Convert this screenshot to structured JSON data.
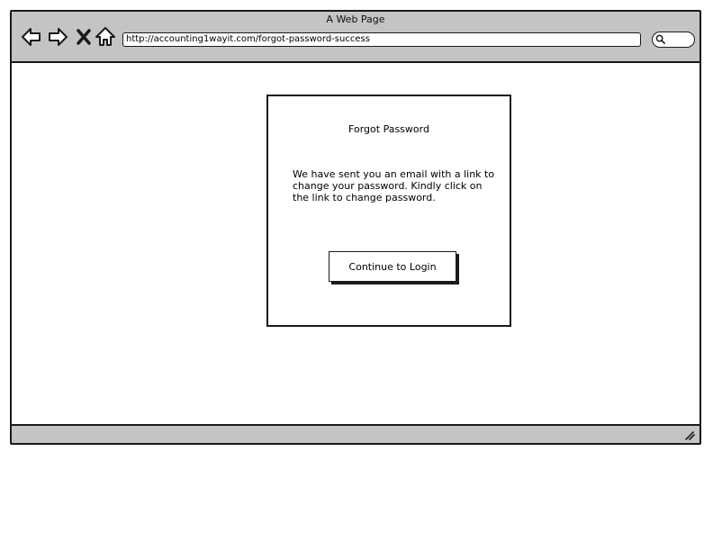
{
  "window": {
    "title": "A Web Page"
  },
  "toolbar": {
    "back_icon": "back-arrow-icon",
    "forward_icon": "forward-arrow-icon",
    "stop_icon": "close-icon",
    "home_icon": "home-icon",
    "url": "http://accounting1wayit.com/forgot-password-success",
    "search_icon": "search-icon"
  },
  "dialog": {
    "title": "Forgot Password",
    "message": "We have sent you an email with a link to change your password. Kindly click on the link to change password.",
    "button_label": "Continue to Login"
  },
  "statusbar": {
    "resize_icon": "resize-grip-icon"
  }
}
